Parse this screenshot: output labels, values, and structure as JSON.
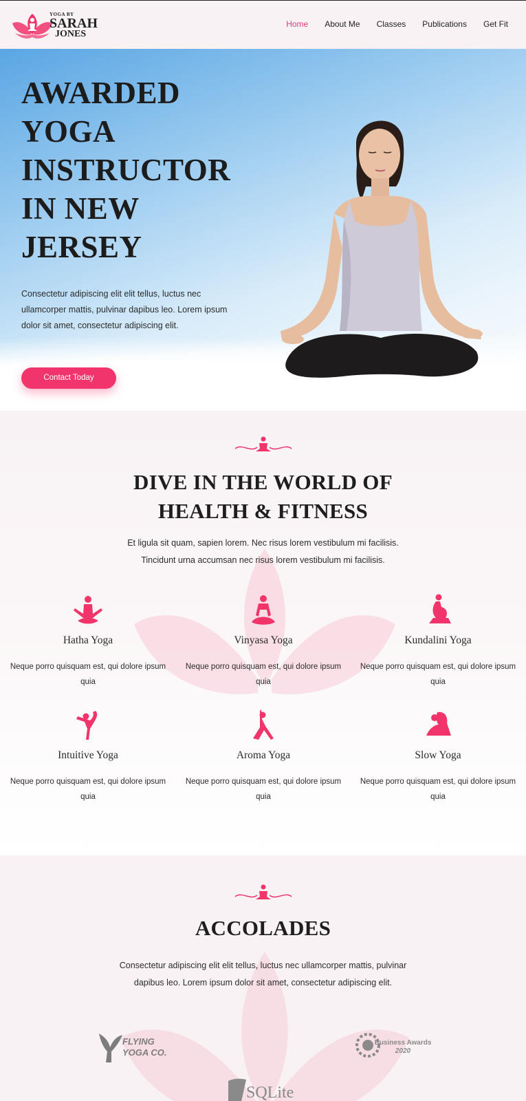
{
  "header": {
    "logo": {
      "small": "YOGA BY",
      "line1": "SARAH",
      "line2": "JONES"
    },
    "nav": [
      {
        "label": "Home",
        "active": true
      },
      {
        "label": "About Me",
        "active": false
      },
      {
        "label": "Classes",
        "active": false
      },
      {
        "label": "Publications",
        "active": false
      },
      {
        "label": "Get Fit",
        "active": false
      }
    ]
  },
  "hero": {
    "title": "AWARDED YOGA INSTRUCTOR IN NEW JERSEY",
    "text": "Consectetur adipiscing elit elit tellus, luctus nec ullamcorper mattis, pulvinar dapibus leo. Lorem ipsum dolor sit amet, consectetur adipiscing elit.",
    "button": "Contact Today"
  },
  "dive": {
    "title_line1": "DIVE IN THE WORLD OF",
    "title_line2": "HEALTH & FITNESS",
    "text": "Et ligula sit quam, sapien lorem. Nec risus lorem vestibulum mi facilisis. Tincidunt urna accumsan nec risus lorem vestibulum mi facilisis.",
    "cards": [
      {
        "title": "Hatha Yoga",
        "text": "Neque porro quisquam est, qui dolore ipsum quia",
        "icon": "meditation-pose-icon"
      },
      {
        "title": "Vinyasa Yoga",
        "text": "Neque porro quisquam est, qui dolore ipsum quia",
        "icon": "seated-pose-icon"
      },
      {
        "title": "Kundalini Yoga",
        "text": "Neque porro quisquam est, qui dolore ipsum quia",
        "icon": "cobra-pose-icon"
      },
      {
        "title": "Intuitive Yoga",
        "text": "Neque porro quisquam est, qui dolore ipsum quia",
        "icon": "dancer-pose-icon"
      },
      {
        "title": "Aroma Yoga",
        "text": "Neque porro quisquam est, qui dolore ipsum quia",
        "icon": "warrior-pose-icon"
      },
      {
        "title": "Slow Yoga",
        "text": "Neque porro quisquam est, qui dolore ipsum quia",
        "icon": "pigeon-pose-icon"
      }
    ]
  },
  "accolades": {
    "title": "ACCOLADES",
    "text": "Consectetur adipiscing elit elit tellus, luctus nec ullamcorper mattis, pulvinar dapibus leo. Lorem ipsum dolor sit amet, consectetur adipiscing elit.",
    "logos": [
      {
        "line1": "FLYING",
        "line2": "YOGA CO."
      },
      {
        "line1": "Business Awards",
        "line2": "2020"
      },
      {
        "line1": "SQLite"
      }
    ]
  },
  "colors": {
    "accent": "#f1356b",
    "nav_active": "#d63c7e",
    "background": "#f8f2f4"
  }
}
